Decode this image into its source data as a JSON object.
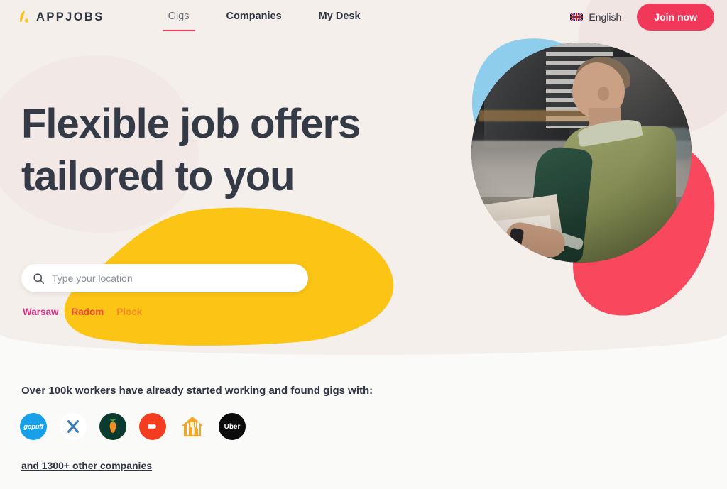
{
  "header": {
    "logo": {
      "icon": "appjobs-logo-icon",
      "text": "APPJOBS"
    },
    "nav": [
      {
        "label": "Gigs",
        "active": true
      },
      {
        "label": "Companies",
        "active": false
      },
      {
        "label": "My Desk",
        "active": false
      }
    ],
    "language": {
      "icon": "uk-flag-icon",
      "label": "English"
    },
    "join_label": "Join now"
  },
  "hero": {
    "headline_line1": "Flexible job offers",
    "headline_line2": "tailored to you",
    "search": {
      "icon": "search-icon",
      "placeholder": "Type your location",
      "value": ""
    },
    "cities": [
      {
        "label": "Warsaw",
        "color": "#D63384"
      },
      {
        "label": "Radom",
        "color": "#F2453D"
      },
      {
        "label": "Plock",
        "color": "#F5891F"
      }
    ],
    "photo_alt": "delivery-worker-photo"
  },
  "bottom": {
    "title": "Over 100k workers have already started working and found gigs with:",
    "brands": [
      {
        "name": "gopuff",
        "label": "gopuff",
        "color": "#18A0E8"
      },
      {
        "name": "x-company",
        "label": "",
        "color": "#FFFFFF"
      },
      {
        "name": "instacart",
        "label": "",
        "color": "#0A3B2E"
      },
      {
        "name": "doordash",
        "label": "",
        "color": "#F33D20"
      },
      {
        "name": "just-eat",
        "label": "",
        "color": "#F5A623"
      },
      {
        "name": "uber",
        "label": "Uber",
        "color": "#0B0B0B"
      }
    ],
    "more_link": "and 1300+ other companies"
  },
  "colors": {
    "background_cream": "#F4EFEA",
    "background_white": "#FAFAF9",
    "accent_red": "#F2385A",
    "accent_yellow": "#FCC414",
    "accent_blue": "#8FCDEC",
    "accent_coral": "#F9485E",
    "text_dark": "#2F3542"
  }
}
